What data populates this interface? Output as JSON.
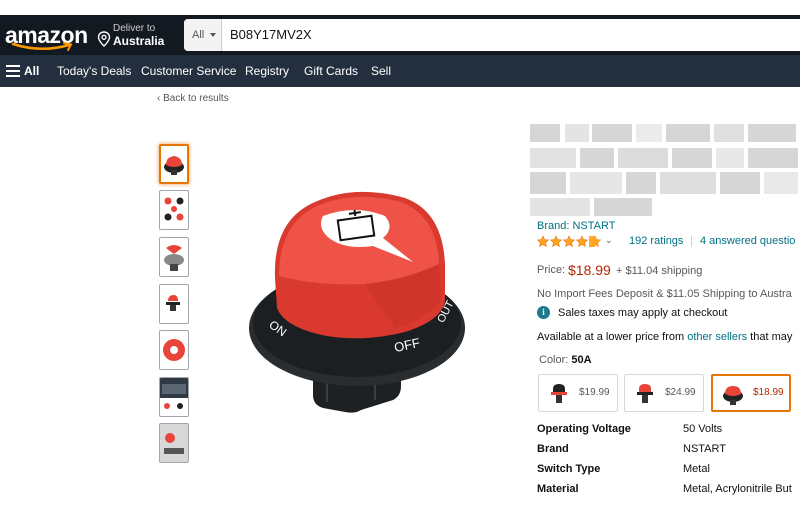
{
  "header": {
    "logo_text": "amazon",
    "deliver_line1": "Deliver to",
    "deliver_line2": "Australia",
    "search_category": "All",
    "search_query": "B08Y17MV2X"
  },
  "nav": {
    "all_label": "All",
    "items": [
      "Today's Deals",
      "Customer Service",
      "Registry",
      "Gift Cards",
      "Sell"
    ]
  },
  "back_link": "‹ Back to results",
  "product": {
    "brand": "Brand: NSTART",
    "rating_stars": 4.5,
    "ratings_count": "192 ratings",
    "separator": "|",
    "answered": "4 answered questio",
    "price_label": "Price:",
    "price": "$18.99",
    "shipping": "+ $11.04 shipping",
    "import_note": "No Import Fees Deposit & $11.05 Shipping to Austra",
    "tax_note": "Sales taxes may apply at checkout",
    "available_prefix": "Available at a lower price from ",
    "available_link": "other sellers",
    "available_suffix": " that may",
    "color_label": "Color:",
    "color_value": "50A",
    "swatches": [
      {
        "price": "$19.99",
        "selected": false
      },
      {
        "price": "$24.99",
        "selected": false
      },
      {
        "price": "$18.99",
        "selected": true
      }
    ],
    "specs": [
      {
        "key": "Operating Voltage",
        "value": "50 Volts"
      },
      {
        "key": "Brand",
        "value": "NSTART"
      },
      {
        "key": "Switch Type",
        "value": "Metal"
      },
      {
        "key": "Material",
        "value": "Metal, Acrylonitrile But"
      }
    ],
    "knob_labels": {
      "on": "ON",
      "off": "OFF",
      "out": "OUT"
    }
  },
  "colors": {
    "nav_belt": "#131921",
    "nav_main": "#232f3e",
    "link": "#007185",
    "price": "#b12704",
    "star": "#ffa41c",
    "knob_red": "#e8443a",
    "selected_border": "#e77600"
  },
  "icons": {
    "location": "location-pin-icon",
    "menu": "hamburger-menu-icon",
    "info": "info-icon",
    "dropdown": "chevron-down-icon"
  }
}
